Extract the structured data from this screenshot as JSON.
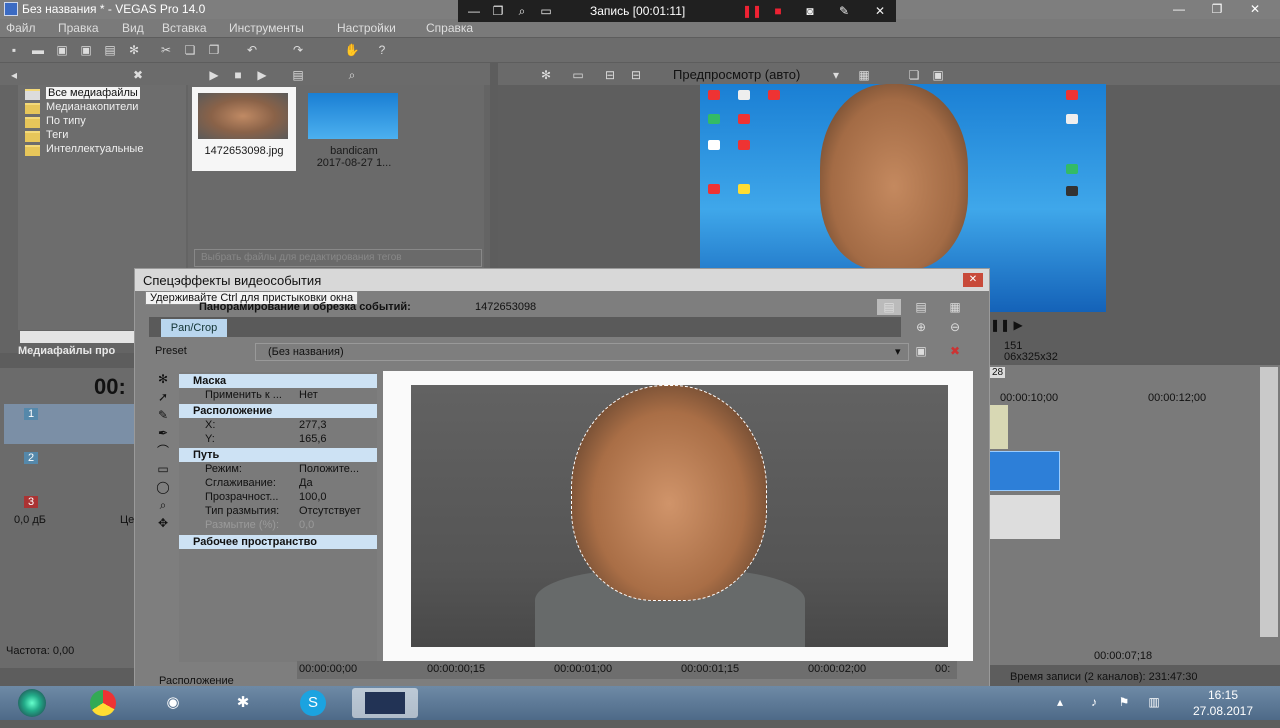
{
  "window": {
    "title": "Без названия * - VEGAS Pro 14.0"
  },
  "menu": [
    "Файл",
    "Правка",
    "Вид",
    "Вставка",
    "Инструменты",
    "Настройки",
    "Справка"
  ],
  "recorder": {
    "label": "Запись [00:01:11]"
  },
  "explorer": {
    "tree": [
      "Все медиафайлы",
      "Медианакопители",
      "По типу",
      "Теги",
      "Интеллектуальные"
    ],
    "media": [
      {
        "name": "1472653098.jpg",
        "date": ""
      },
      {
        "name": "bandicam",
        "date": "2017-08-27 1..."
      }
    ],
    "search_placeholder": "Выбрать файлы для редактирования тегов",
    "panel_label": "Медиафайлы про"
  },
  "preview": {
    "mode": "Предпросмотр (авто)",
    "frame": "151",
    "resolution": "06x325x32"
  },
  "timeline": {
    "timecode": "00:",
    "tracks": [
      {
        "num": "1"
      },
      {
        "num": "2"
      },
      {
        "num": "3",
        "volume": "0,0 дБ",
        "extra": "Це"
      }
    ],
    "ruler": [
      "00:00:10;00",
      "00:00:12;00"
    ],
    "marker": "28"
  },
  "fx": {
    "title": "Спецэффекты видеособытия",
    "tooltip": "Удерживайте Ctrl для пристыковки окна",
    "event_label": "Панорамирование и обрезка событий:",
    "event_name": "1472653098",
    "chain_item": "Pan/Crop",
    "preset_label": "Preset",
    "preset_value": "(Без названия)",
    "sections": {
      "mask": "Маска",
      "position": "Расположение",
      "path": "Путь",
      "workspace": "Рабочее пространство"
    },
    "props": {
      "apply_k": "Применить к ...",
      "apply_v": "Нет",
      "x_k": "X:",
      "x_v": "277,3",
      "y_k": "Y:",
      "y_v": "165,6",
      "mode_k": "Режим:",
      "mode_v": "Положите...",
      "smooth_k": "Сглаживание:",
      "smooth_v": "Да",
      "opacity_k": "Прозрачност...",
      "opacity_v": "100,0",
      "blurtype_k": "Тип размытия:",
      "blurtype_v": "Отсутствует",
      "blur_k": "Размытие (%):",
      "blur_v": "0,0"
    },
    "timeline": [
      "00:00:00;00",
      "00:00:00;15",
      "00:00:01;00",
      "00:00:01;15",
      "00:00:02;00",
      "00:"
    ],
    "bottom_label": "Расположение"
  },
  "status": {
    "frequency": "Частота: 0,00",
    "time": "00:00:07;18",
    "rec_time": "Время записи (2 каналов): 231:47:30"
  },
  "taskbar": {
    "clock_time": "16:15",
    "clock_date": "27.08.2017"
  },
  "colors": {
    "accent": "#cde2f4",
    "close": "#c84a3a"
  }
}
